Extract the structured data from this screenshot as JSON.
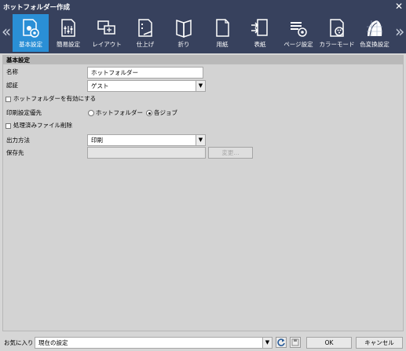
{
  "window": {
    "title": "ホットフォルダー作成",
    "close_glyph": "✕"
  },
  "toolbar": {
    "prev_glyph": "«",
    "next_glyph": "»",
    "items": [
      {
        "label": "基本設定",
        "icon": "basic-settings-icon",
        "active": true
      },
      {
        "label": "簡易設定",
        "icon": "quick-settings-icon"
      },
      {
        "label": "レイアウト",
        "icon": "layout-icon"
      },
      {
        "label": "仕上げ",
        "icon": "finishing-icon"
      },
      {
        "label": "折り",
        "icon": "fold-icon"
      },
      {
        "label": "用紙",
        "icon": "paper-icon"
      },
      {
        "label": "表紙",
        "icon": "cover-icon"
      },
      {
        "label": "ページ設定",
        "icon": "page-settings-icon"
      },
      {
        "label": "カラーモード",
        "icon": "color-mode-icon"
      },
      {
        "label": "色変換設定",
        "icon": "color-conversion-icon"
      }
    ]
  },
  "section": {
    "title": "基本設定"
  },
  "form": {
    "name_label": "名称",
    "name_value": "ホットフォルダー",
    "auth_label": "認証",
    "auth_value": "ゲスト",
    "enable_label": "ホットフォルダーを有効にする",
    "priority_label": "印刷設定優先",
    "priority_option_hotfolder": "ホットフォルダー",
    "priority_option_each_job": "各ジョブ",
    "delete_processed_label": "処理済みファイル削除",
    "output_label": "出力方法",
    "output_value": "印刷",
    "save_to_label": "保存先",
    "save_to_value": "",
    "change_button": "変更..."
  },
  "footer": {
    "favorites_label": "お気に入り",
    "favorites_value": "現在の設定",
    "ok_button": "OK",
    "cancel_button": "キャンセル"
  },
  "colors": {
    "accent": "#2a8fd6",
    "toolbar_bg": "#37415d",
    "panel_bg": "#d3d3d3"
  }
}
